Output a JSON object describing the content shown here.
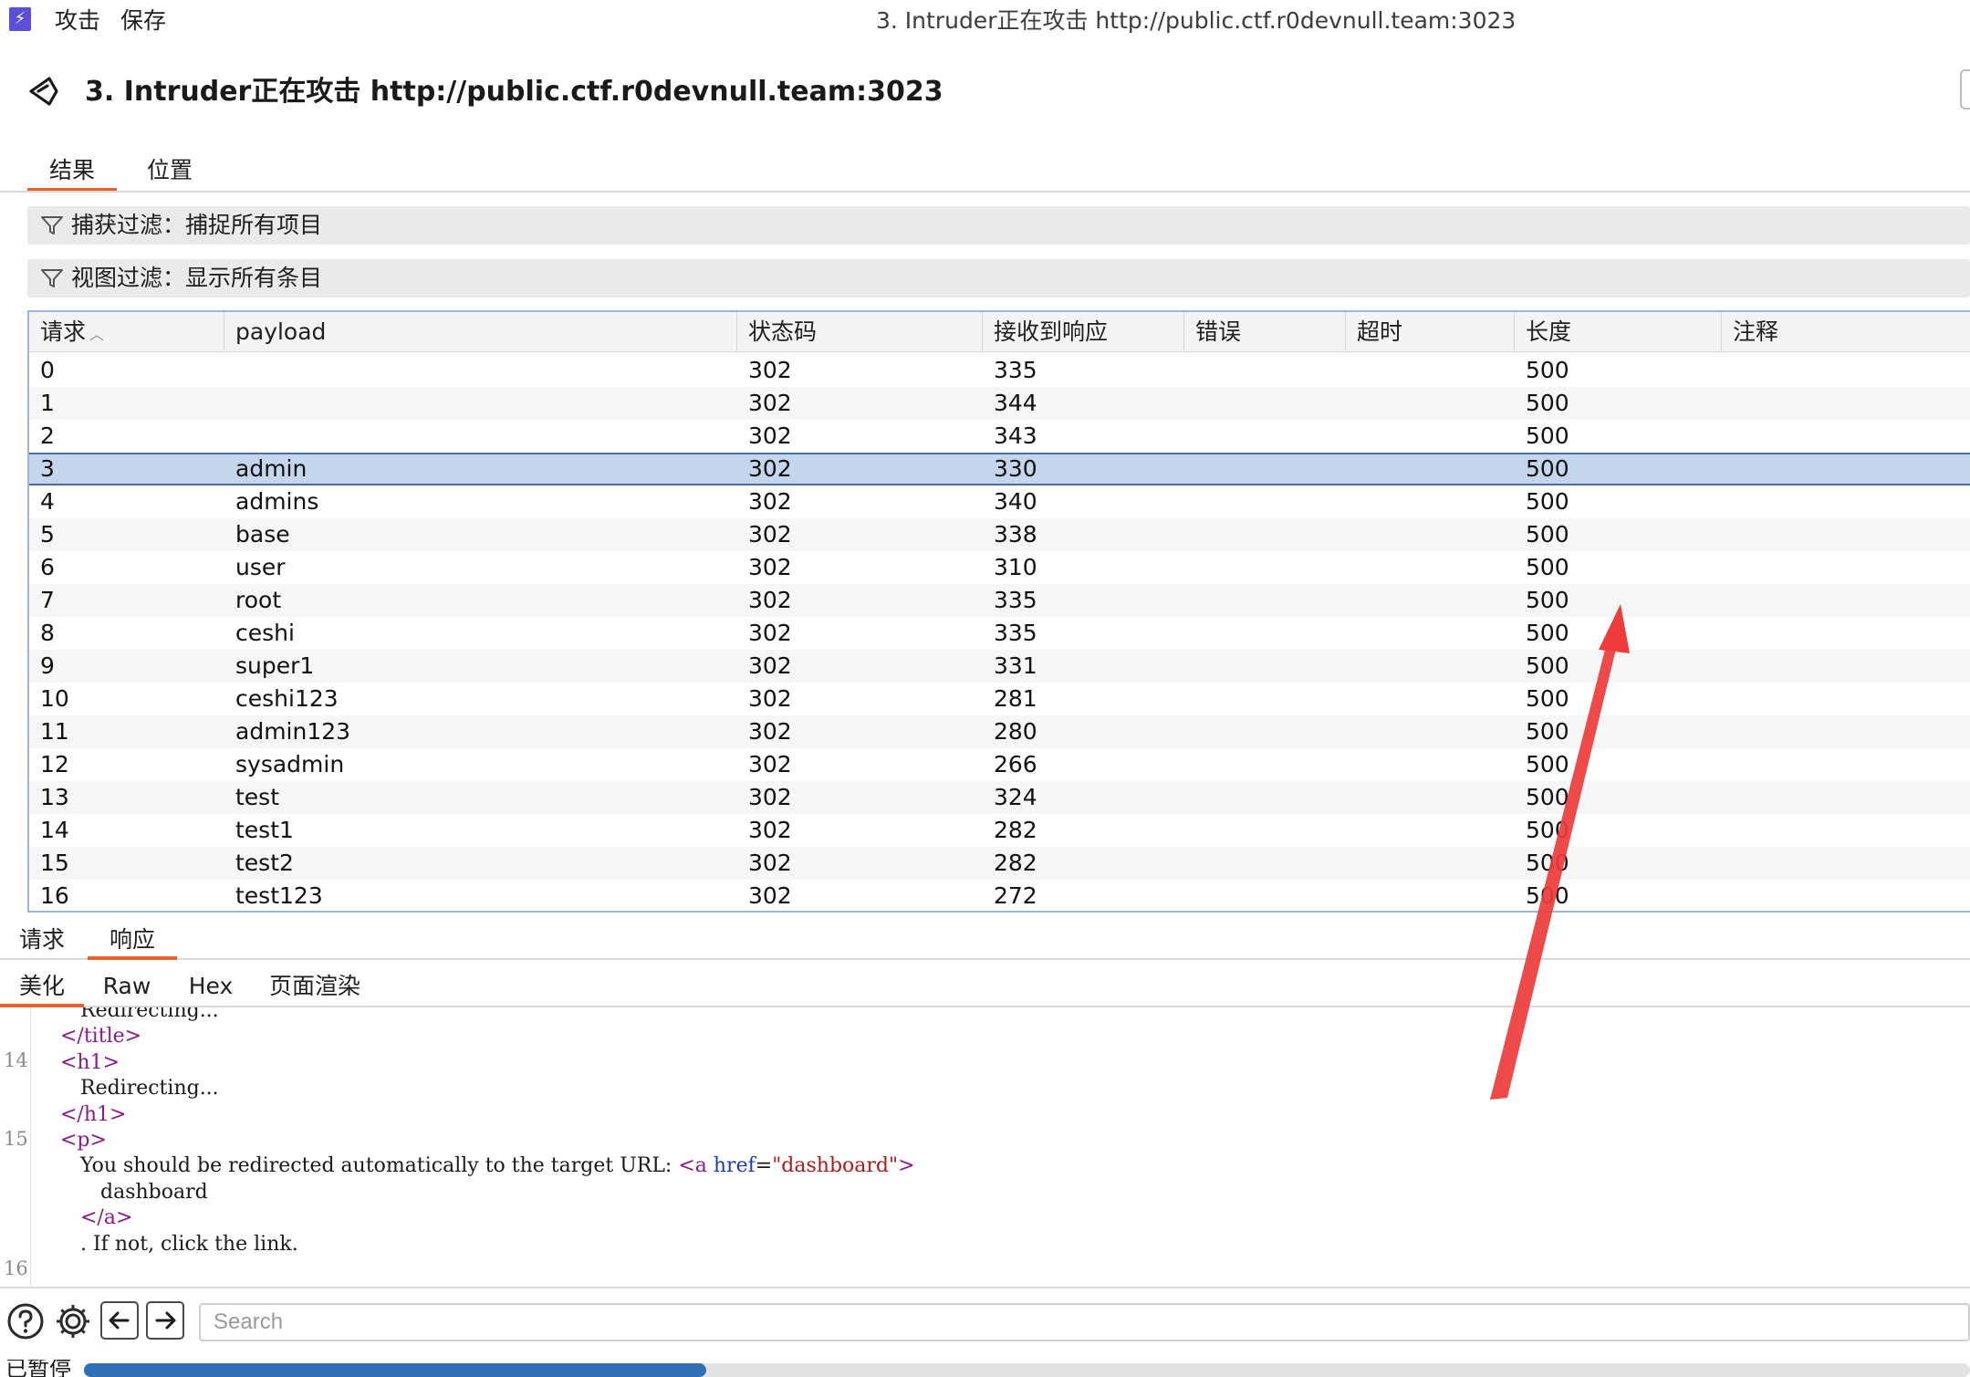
{
  "menubar": {
    "logo_glyph": "⚡",
    "items": [
      "攻击",
      "保存"
    ],
    "window_title": "3. Intruder正在攻击 http://public.ctf.r0devnull.team:3023"
  },
  "header": {
    "title": "3. Intruder正在攻击 http://public.ctf.r0devnull.team:3023"
  },
  "tabs": [
    {
      "label": "结果",
      "active": true
    },
    {
      "label": "位置",
      "active": false
    }
  ],
  "filters": {
    "capture": "捕获过滤：捕捉所有项目",
    "view": "视图过滤：显示所有条目"
  },
  "table": {
    "columns": [
      "请求",
      "payload",
      "状态码",
      "接收到响应",
      "错误",
      "超时",
      "长度",
      "注释"
    ],
    "sorted_column": "请求",
    "selected_row": 3,
    "rows": [
      [
        "0",
        "",
        "302",
        "335",
        "",
        "",
        "500",
        ""
      ],
      [
        "1",
        "",
        "302",
        "344",
        "",
        "",
        "500",
        ""
      ],
      [
        "2",
        "",
        "302",
        "343",
        "",
        "",
        "500",
        ""
      ],
      [
        "3",
        "admin",
        "302",
        "330",
        "",
        "",
        "500",
        ""
      ],
      [
        "4",
        "admins",
        "302",
        "340",
        "",
        "",
        "500",
        ""
      ],
      [
        "5",
        "base",
        "302",
        "338",
        "",
        "",
        "500",
        ""
      ],
      [
        "6",
        "user",
        "302",
        "310",
        "",
        "",
        "500",
        ""
      ],
      [
        "7",
        "root",
        "302",
        "335",
        "",
        "",
        "500",
        ""
      ],
      [
        "8",
        "ceshi",
        "302",
        "335",
        "",
        "",
        "500",
        ""
      ],
      [
        "9",
        "super1",
        "302",
        "331",
        "",
        "",
        "500",
        ""
      ],
      [
        "10",
        "ceshi123",
        "302",
        "281",
        "",
        "",
        "500",
        ""
      ],
      [
        "11",
        "admin123",
        "302",
        "280",
        "",
        "",
        "500",
        ""
      ],
      [
        "12",
        "sysadmin",
        "302",
        "266",
        "",
        "",
        "500",
        ""
      ],
      [
        "13",
        "test",
        "302",
        "324",
        "",
        "",
        "500",
        ""
      ],
      [
        "14",
        "test1",
        "302",
        "282",
        "",
        "",
        "500",
        ""
      ],
      [
        "15",
        "test2",
        "302",
        "282",
        "",
        "",
        "500",
        ""
      ],
      [
        "16",
        "test123",
        "302",
        "272",
        "",
        "",
        "500",
        ""
      ]
    ]
  },
  "rr_tabs": [
    {
      "label": "请求",
      "active": false
    },
    {
      "label": "响应",
      "active": true
    }
  ],
  "view_tabs": [
    {
      "label": "美化",
      "active": true
    },
    {
      "label": "Raw",
      "active": false
    },
    {
      "label": "Hex",
      "active": false
    },
    {
      "label": "页面渲染",
      "active": false
    }
  ],
  "code": {
    "line_numbers": [
      "14",
      "15",
      "16"
    ],
    "lines": [
      {
        "indent": 2,
        "parts": [
          [
            "text",
            "Redirecting..."
          ]
        ]
      },
      {
        "indent": 1,
        "parts": [
          [
            "tag",
            "</title>"
          ]
        ]
      },
      {
        "indent": 1,
        "parts": [
          [
            "tag",
            "<h1>"
          ]
        ]
      },
      {
        "indent": 2,
        "parts": [
          [
            "text",
            "Redirecting..."
          ]
        ]
      },
      {
        "indent": 1,
        "parts": [
          [
            "tag",
            "</h1>"
          ]
        ]
      },
      {
        "indent": 1,
        "parts": [
          [
            "tag",
            "<p>"
          ]
        ]
      },
      {
        "indent": 2,
        "parts": [
          [
            "text",
            "You should be redirected automatically to the target URL: "
          ],
          [
            "tag",
            "<a "
          ],
          [
            "attr",
            "href"
          ],
          [
            "text",
            "="
          ],
          [
            "val",
            "\"dashboard\""
          ],
          [
            "tag",
            ">"
          ]
        ]
      },
      {
        "indent": 3,
        "parts": [
          [
            "text",
            "dashboard"
          ]
        ]
      },
      {
        "indent": 2,
        "parts": [
          [
            "tag",
            "</a>"
          ]
        ]
      },
      {
        "indent": 2,
        "parts": [
          [
            "text",
            ". If not, click the link."
          ]
        ]
      }
    ]
  },
  "search": {
    "placeholder": "Search"
  },
  "status": {
    "text": "已暂停",
    "progress": 0.33
  },
  "colors": {
    "accent": "#e8622b",
    "selected_row": "#c5d5ec",
    "progress": "#2f6fb3",
    "annotation_arrow": "#ee3b3b"
  }
}
